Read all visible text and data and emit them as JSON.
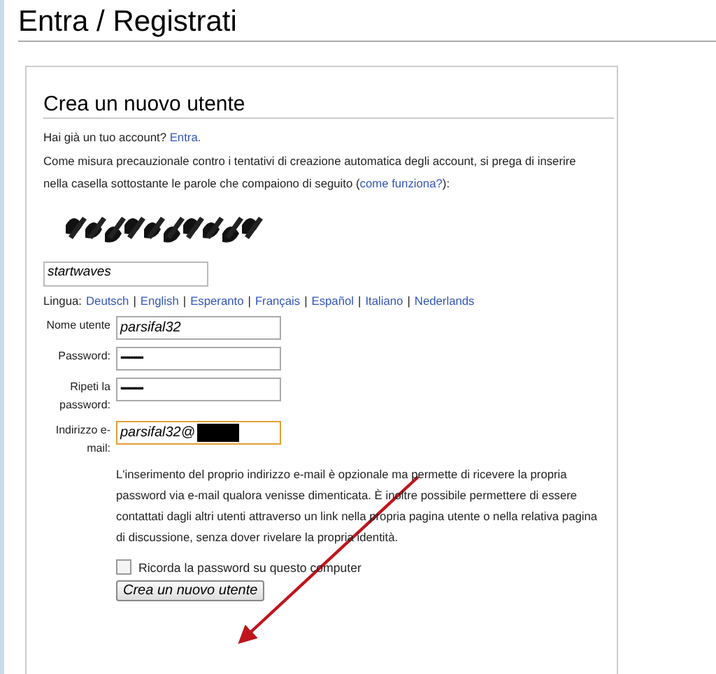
{
  "page_title": "Entra / Registrati",
  "form": {
    "heading": "Crea un nuovo utente",
    "have_account": {
      "text": "Hai già un tuo account?",
      "link": "Entra."
    },
    "captcha_intro": {
      "text": "Come misura precauzionale contro i tentativi di creazione automatica degli account, si prega di inserire nella casella sottostante le parole che compaiono di seguito (",
      "link": "come funziona?",
      "after": "):"
    },
    "captcha_answer": "startwaves",
    "language": {
      "label": "Lingua:",
      "separator": "|",
      "options": [
        "Deutsch",
        "English",
        "Esperanto",
        "Français",
        "Español",
        "Italiano",
        "Nederlands"
      ]
    },
    "fields": [
      {
        "label": "Nome utente",
        "value": "parsifal32",
        "kind": "text",
        "focused": false
      },
      {
        "label": "Password:",
        "value": "•••••••••••",
        "kind": "password",
        "focused": false
      },
      {
        "label": "Ripeti la password:",
        "value": "•••••••••••",
        "kind": "password",
        "focused": false
      },
      {
        "label": "Indirizzo e-mail:",
        "value": "parsifal32@",
        "kind": "email",
        "focused": true,
        "redacted": true
      }
    ],
    "email_note": "L'inserimento del proprio indirizzo e-mail è opzionale ma permette di ricevere la propria password via e-mail qualora venisse dimenticata. È inoltre possibile permettere di essere contattati dagli altri utenti attraverso un link nella propria pagina utente o nella relativa pagina di discussione, senza dover rivelare la propria identità.",
    "remember": {
      "label": "Ricorda la password su questo computer",
      "checked": false
    },
    "submit": "Crea un nuovo utente"
  }
}
